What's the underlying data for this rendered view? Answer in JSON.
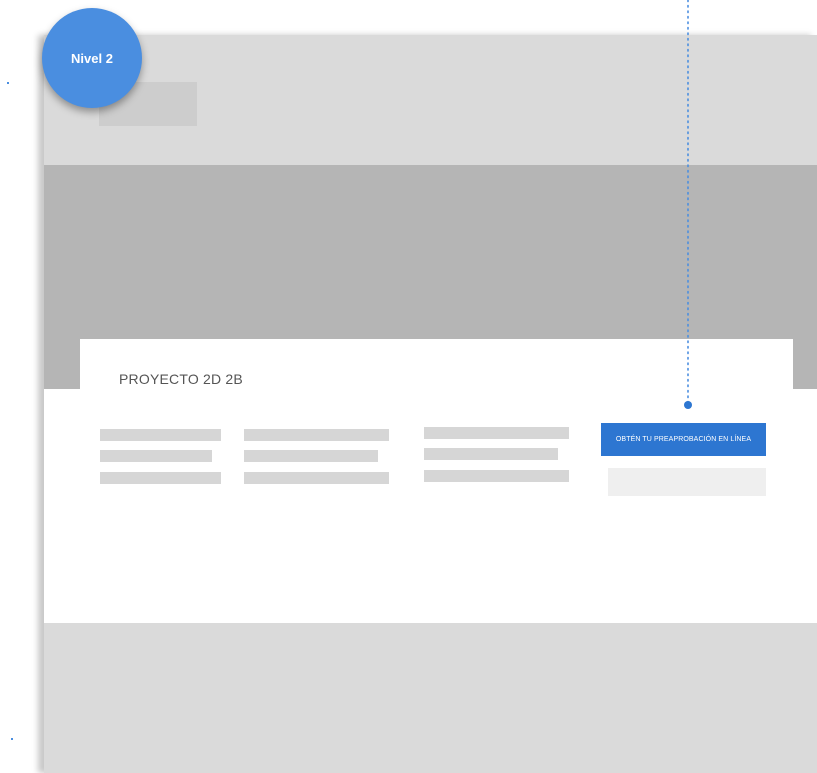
{
  "annotation": {
    "level_label": "Nivel 2",
    "color": "#4a8ee0"
  },
  "page": {
    "project_title": "PROYECTO 2D 2B",
    "cta_label": "OBTÉN TU PREAPROBACIÓN EN LÍNEA",
    "colors": {
      "header": "#dadada",
      "hero": "#b5b5b5",
      "cta": "#2d76d1",
      "placeholder": "#d6d6d6"
    }
  }
}
